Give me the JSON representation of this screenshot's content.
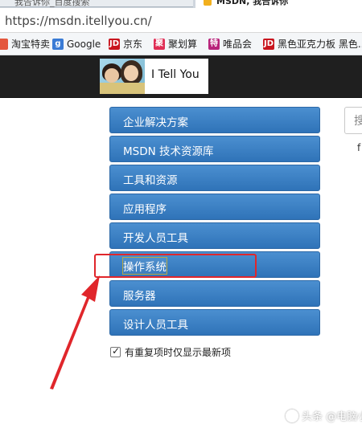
{
  "browser": {
    "tabs": [
      {
        "label": "我告诉你_百度搜索",
        "active": false
      },
      {
        "label": "MSDN, 我告诉你",
        "active": true
      }
    ],
    "url": "https://msdn.itellyou.cn/"
  },
  "bookmarks": [
    {
      "label": "淘宝特卖",
      "icon": "taobao-icon",
      "color": "#e4573d"
    },
    {
      "label": "Google",
      "icon": "google-icon",
      "color": "#3a7bd5"
    },
    {
      "label": "京东",
      "icon": "jd-icon",
      "color": "#c9151e"
    },
    {
      "label": "聚划算",
      "icon": "juhuasuan-icon",
      "color": "#e02e55"
    },
    {
      "label": "唯品会",
      "icon": "vip-icon",
      "color": "#b8237a"
    },
    {
      "label": "黑色亚克力板 黑色...",
      "icon": "jd-icon",
      "color": "#c9151e"
    }
  ],
  "logo": {
    "text": "I Tell You"
  },
  "search": {
    "placeholder": "搜"
  },
  "side_text": "f",
  "menu": {
    "items": [
      {
        "label": "企业解决方案"
      },
      {
        "label": "MSDN 技术资源库"
      },
      {
        "label": "工具和资源"
      },
      {
        "label": "应用程序"
      },
      {
        "label": "开发人员工具"
      },
      {
        "label": "操作系统",
        "highlighted": true
      },
      {
        "label": "服务器"
      },
      {
        "label": "设计人员工具"
      }
    ]
  },
  "filter": {
    "label": "有重复项时仅显示最新项",
    "checked": true
  },
  "watermark": {
    "text": "头条 @电脑小白"
  },
  "colors": {
    "menu_bg": "#3a7fc4",
    "annotation": "#e0262b",
    "header_bg": "#1f1f1f"
  }
}
